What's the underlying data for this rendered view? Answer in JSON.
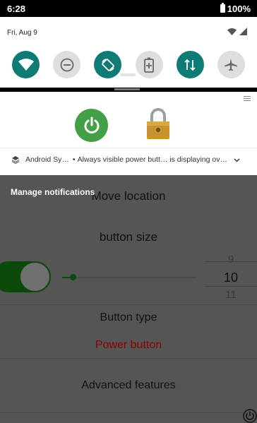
{
  "status_bar": {
    "time": "6:28",
    "battery": "100%"
  },
  "quick_settings": {
    "date": "Fri, Aug 9",
    "tiles": [
      {
        "name": "wifi",
        "on": true
      },
      {
        "name": "do-not-disturb",
        "on": false
      },
      {
        "name": "auto-rotate",
        "on": true
      },
      {
        "name": "battery-saver",
        "on": false
      },
      {
        "name": "mobile-data",
        "on": true
      },
      {
        "name": "airplane-mode",
        "on": false
      }
    ]
  },
  "notification": {
    "app_name": "Android Sy…",
    "bullet": "•",
    "message": "Always visible power butt… is displaying ov…"
  },
  "manage_label": "Manage notifications",
  "app": {
    "move_location": "Move location",
    "button_size": "button size",
    "picker": {
      "above": "9",
      "selected": "10",
      "below": "11"
    },
    "button_type": "Button type",
    "power_button": "Power button",
    "advanced": "Advanced features"
  },
  "colors": {
    "accent": "#0e7c74",
    "power_green": "#43a047",
    "power_label": "#8b0000"
  }
}
